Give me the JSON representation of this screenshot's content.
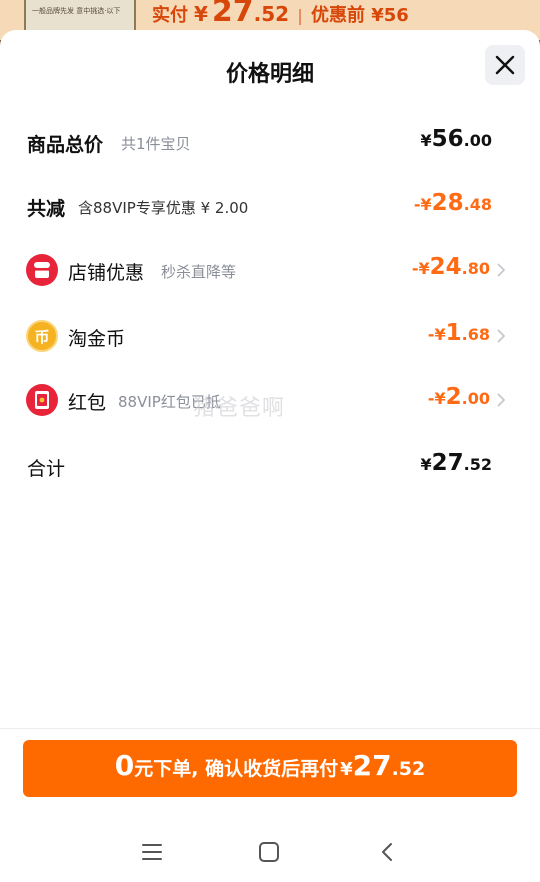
{
  "background": {
    "thumb_text": "一般品牌先发 意中挑选·以下",
    "price_label": "实付",
    "price_yen": "¥",
    "price_int": "27",
    "price_dec": ".52",
    "separator": "|",
    "before_text": "优惠前 ¥56"
  },
  "sheet": {
    "title": "价格明细",
    "close_icon": "close-icon"
  },
  "rows": [
    {
      "label": "商品总价",
      "sub": "共1件宝贝",
      "sign": "",
      "yen": "¥",
      "int": "56",
      "dec": ".00"
    },
    {
      "label": "共减",
      "sub": "含88VIP专享优惠 ¥ 2.00",
      "sign": "-",
      "yen": "¥",
      "int": "28",
      "dec": ".48"
    },
    {
      "label": "店铺优惠",
      "sub": "秒杀直降等",
      "sign": "-",
      "yen": "¥",
      "int": "24",
      "dec": ".80",
      "icon": "shop-icon"
    },
    {
      "label": "淘金币",
      "sub": "",
      "sign": "-",
      "yen": "¥",
      "int": "1",
      "dec": ".68",
      "icon": "coin-icon",
      "icon_glyph": "币"
    },
    {
      "label": "红包",
      "sub": "88VIP红包已抵",
      "sign": "-",
      "yen": "¥",
      "int": "2",
      "dec": ".00",
      "icon": "red-envelope-icon"
    },
    {
      "label": "合计",
      "sub": "",
      "sign": "",
      "yen": "¥",
      "int": "27",
      "dec": ".52"
    }
  ],
  "watermark": "猪爸爸啊",
  "cta": {
    "zero": "0",
    "text": "元下单, 确认收货后再付",
    "yen": "¥",
    "int": "27",
    "dec": ".52"
  },
  "navbar": {
    "menu_icon": "menu-icon",
    "home_icon": "home-icon",
    "back_icon": "back-icon"
  },
  "colors": {
    "accent": "#ff6a00",
    "discount": "#ff6a14",
    "shop_red": "#e8243a",
    "coin_gold": "#f5b323"
  }
}
